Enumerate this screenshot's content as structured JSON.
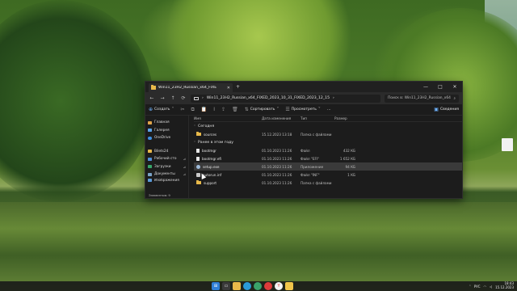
{
  "window": {
    "tab_title": "Win11_23H2_Russian_x64_FIXE",
    "tab_close": "✕",
    "tab_add": "+",
    "controls": {
      "minimize": "—",
      "maximize": "□",
      "close": "✕"
    }
  },
  "address": {
    "back": "←",
    "forward": "→",
    "up": "↑",
    "refresh": "⟳",
    "sep": "›",
    "path": "Win11_23H2_Russian_x64_FIXED_2023_10_31_FIXED_2023_12_15",
    "path_end": "›",
    "search_placeholder": "Поиск в: Win11_23H2_Russian_x64"
  },
  "toolbar": {
    "create": "Создать",
    "sort": "Сортировать",
    "view": "Просмотреть",
    "more": "···",
    "details": "Сведения"
  },
  "sidebar": {
    "items": [
      {
        "label": "Главная",
        "color": "#e0a54a"
      },
      {
        "label": "Галерея",
        "color": "#5aa3e6"
      },
      {
        "label": "OneDrive",
        "color": "#3d8fe0"
      },
      {
        "label": "Bilets24",
        "color": "#e8b94a"
      },
      {
        "label": "Рабочий сто",
        "color": "#4f8fd8"
      },
      {
        "label": "Загрузки",
        "color": "#37a66a"
      },
      {
        "label": "Документы",
        "color": "#7aa3c7"
      },
      {
        "label": "Изображения",
        "color": "#5a9ad8"
      }
    ],
    "pin": "📌"
  },
  "columns": {
    "name": "Имя",
    "date": "Дата изменения",
    "type": "Тип",
    "size": "Размер"
  },
  "groups": {
    "today": "Сегодня",
    "earlier": "Ранее в этом году"
  },
  "files_today": [
    {
      "name": "sources",
      "date": "15.12.2023 13:18",
      "type": "Папка с файлами",
      "size": "",
      "kind": "folder"
    }
  ],
  "files_earlier": [
    {
      "name": "bootmgr",
      "date": "01.10.2023 11:26",
      "type": "Файл",
      "size": "432 КБ",
      "kind": "file"
    },
    {
      "name": "bootmgr.efi",
      "date": "01.10.2023 11:26",
      "type": "Файл \"EFI\"",
      "size": "1 652 КБ",
      "kind": "file"
    },
    {
      "name": "setup.exe",
      "date": "01.10.2023 11:26",
      "type": "Приложение",
      "size": "94 КБ",
      "kind": "exe"
    },
    {
      "name": "autorun.inf",
      "date": "01.10.2023 11:26",
      "type": "Файл \"INF\"",
      "size": "1 КБ",
      "kind": "file"
    },
    {
      "name": "support",
      "date": "01.10.2023 11:26",
      "type": "Папка с файлами",
      "size": "",
      "kind": "folder"
    }
  ],
  "status": "Элементов: 9",
  "tray": {
    "lang": "РУС",
    "time": "18:43",
    "date": "15.12.2023"
  }
}
